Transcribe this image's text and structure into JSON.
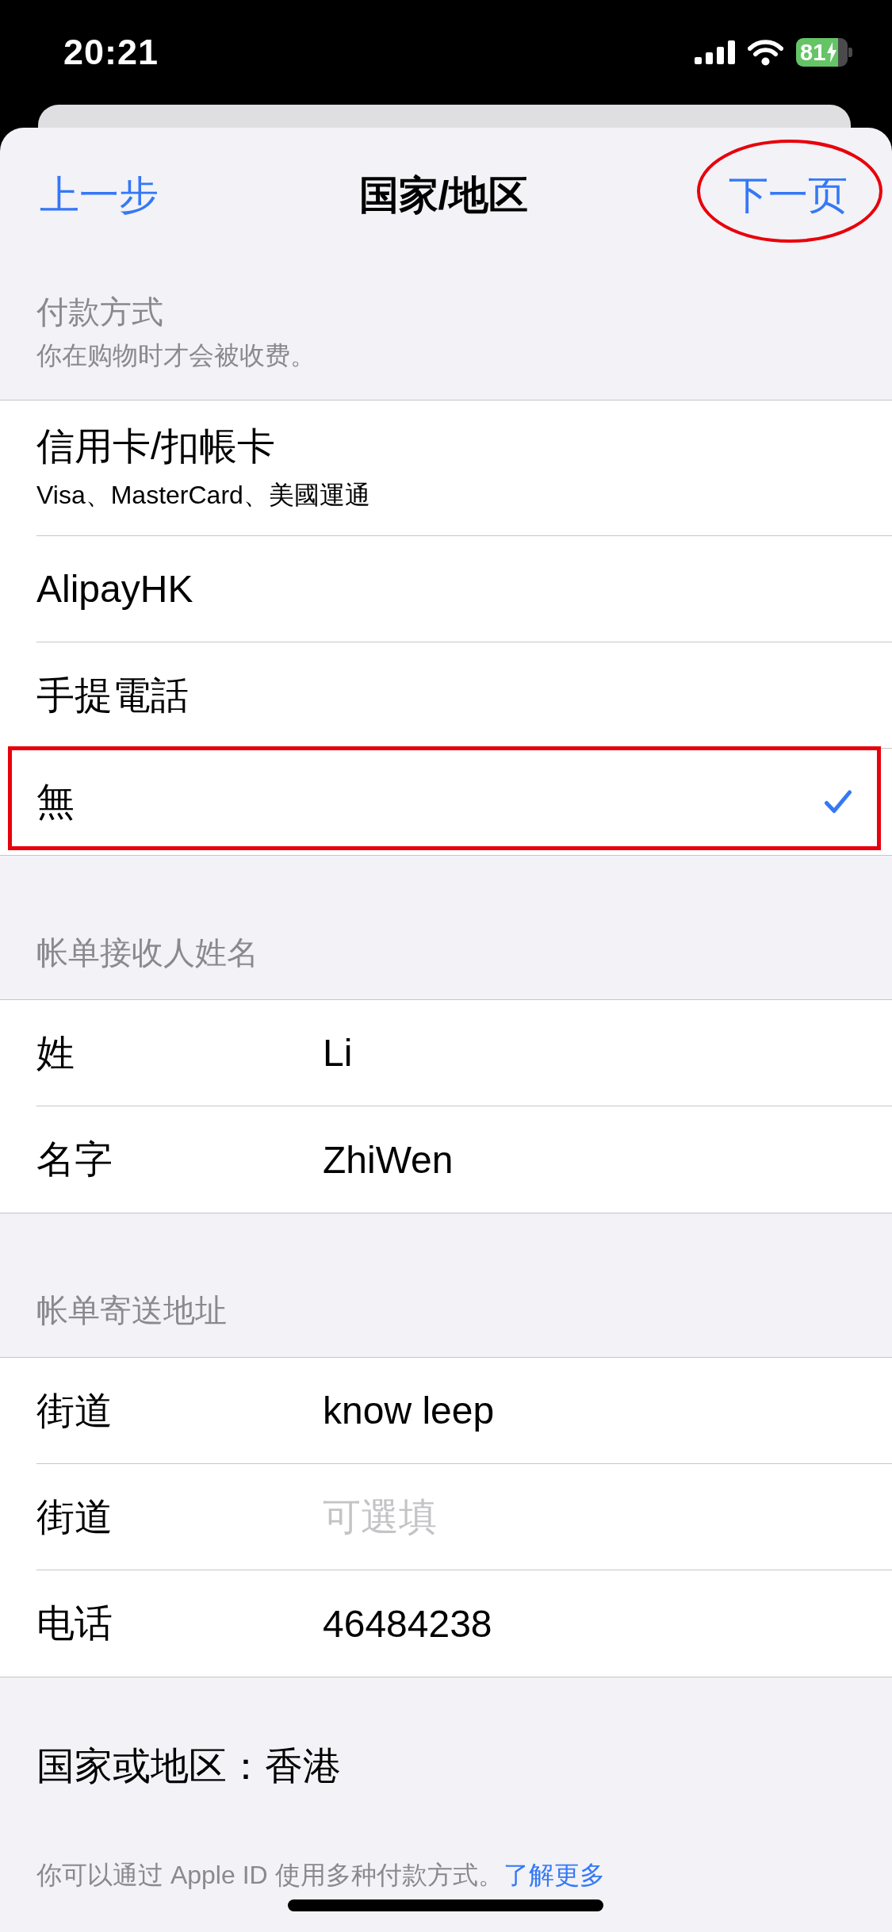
{
  "status_bar": {
    "time": "20:21",
    "battery": "81"
  },
  "nav": {
    "back": "上一步",
    "title": "国家/地区",
    "next": {
      "label": "下一页",
      "circled": true
    }
  },
  "payment": {
    "header": "付款方式",
    "note": "你在购物时才会被收费。",
    "options": [
      {
        "label": "信用卡/扣帳卡",
        "detail": "Visa、MasterCard、美國運通",
        "selected": false,
        "boxed": false
      },
      {
        "label": "AlipayHK",
        "selected": false,
        "boxed": false
      },
      {
        "label": "手提電話",
        "selected": false,
        "boxed": false
      },
      {
        "label": "無",
        "selected": true,
        "boxed": true
      }
    ]
  },
  "billing_name": {
    "header": "帐单接收人姓名",
    "fields": [
      {
        "label": "姓",
        "value": "Li"
      },
      {
        "label": "名字",
        "value": "ZhiWen"
      }
    ]
  },
  "billing_address": {
    "header": "帐单寄送地址",
    "fields": [
      {
        "label": "街道",
        "value": "know leep"
      },
      {
        "label": "街道",
        "placeholder": "可選填"
      },
      {
        "label": "电话",
        "value": "46484238"
      }
    ]
  },
  "country": "国家或地区：香港",
  "footer": {
    "text": "你可以通过 Apple ID 使用多种付款方式。",
    "link": "了解更多"
  }
}
